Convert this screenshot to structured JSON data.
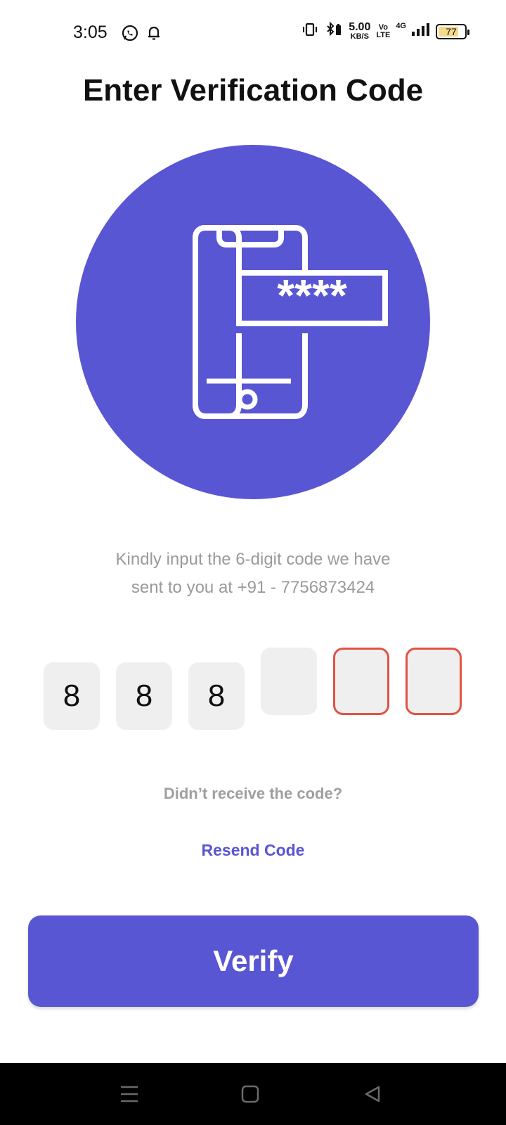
{
  "status_bar": {
    "time": "3:05",
    "net_speed_value": "5.00",
    "net_speed_unit": "KB/S",
    "volte_top": "Vo",
    "volte_bottom": "LTE",
    "network_type": "4G",
    "battery_level": "77",
    "battery_fraction": 0.77,
    "icons": [
      "whatsapp-icon",
      "bell-icon",
      "vibrate-icon",
      "bluetooth-icon",
      "signal-icon",
      "battery-icon"
    ]
  },
  "title": "Enter Verification Code",
  "illustration": {
    "masked_code": "****",
    "circle_color": "#5956d4"
  },
  "instruction": {
    "line1": "Kindly input the 6-digit code we have",
    "line2": "sent to you at  +91 - 7756873424"
  },
  "otp": {
    "digits": [
      "8",
      "8",
      "8",
      "",
      "",
      ""
    ],
    "states": [
      "filled",
      "filled",
      "filled",
      "focused",
      "error",
      "error"
    ]
  },
  "resend": {
    "prompt": "Didn’t receive the code?",
    "link": "Resend Code"
  },
  "verify_label": "Verify",
  "colors": {
    "accent": "#5956d4",
    "error": "#e05346",
    "box_bg": "#efefef",
    "muted_text": "#9a9a9a"
  },
  "nav_bar": {
    "icons": [
      "menu-icon",
      "home-icon",
      "back-icon"
    ]
  }
}
